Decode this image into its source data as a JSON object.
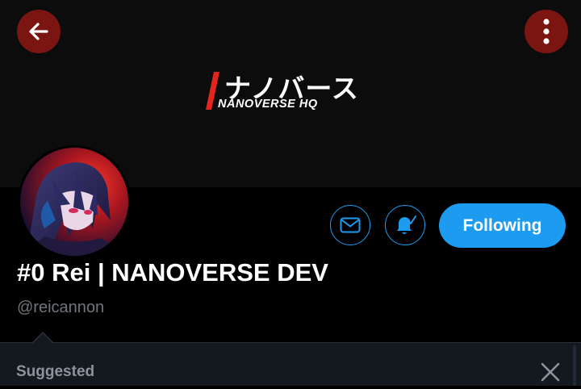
{
  "header": {
    "back_icon": "arrow-left-icon",
    "more_icon": "more-vertical-icon",
    "button_color": "#7a1511"
  },
  "banner": {
    "logo_jp": "ナノバース",
    "logo_en": "NANOVERSE HQ",
    "accent_color": "#e3261d"
  },
  "profile": {
    "name": "#0 Rei | NANOVERSE DEV",
    "handle": "@reicannon",
    "avatar_icon": "avatar"
  },
  "actions": {
    "message_icon": "mail-icon",
    "notify_icon": "bell-check-icon",
    "follow_label": "Following",
    "accent_color": "#1d9bf0"
  },
  "suggested": {
    "label": "Suggested",
    "close_icon": "close-icon"
  }
}
